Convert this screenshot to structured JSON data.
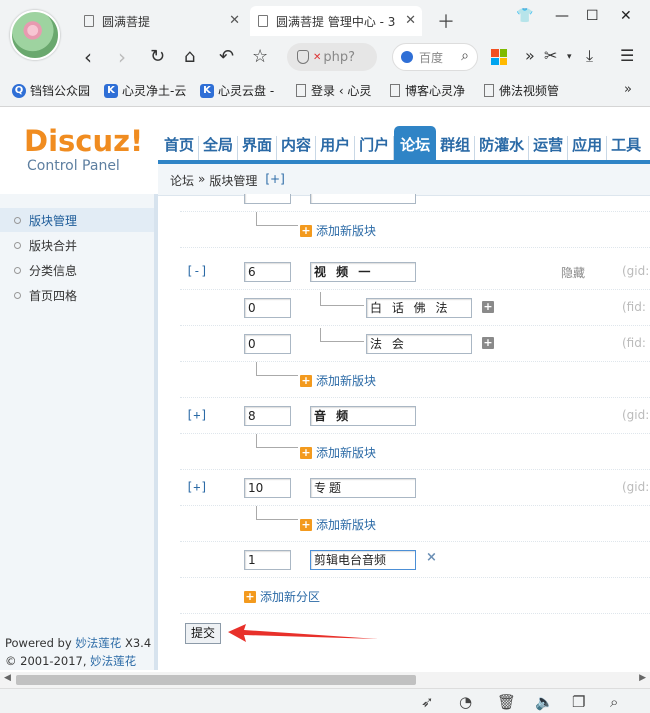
{
  "browser": {
    "tabs": [
      {
        "title": "圆满菩提"
      },
      {
        "title": "圆满菩提 管理中心 - 3"
      }
    ],
    "address_text": "php?",
    "search_placeholder": "百度",
    "bookmarks": [
      {
        "label": "铛铛公众园",
        "icon_color": "#2f6fd6",
        "icon": "Q"
      },
      {
        "label": "心灵净土-云",
        "icon_color": "#2f6fd6",
        "icon": "K"
      },
      {
        "label": "心灵云盘 -",
        "icon_color": "#2f6fd6",
        "icon": "K"
      },
      {
        "label": "登录 ‹ 心灵",
        "icon_color": "",
        "icon": "doc"
      },
      {
        "label": "博客心灵净",
        "icon_color": "",
        "icon": "doc"
      },
      {
        "label": "佛法视频管",
        "icon_color": "",
        "icon": "doc"
      }
    ]
  },
  "logo": {
    "main": "Discuz!",
    "sub": "Control Panel"
  },
  "topnav": [
    "首页",
    "全局",
    "界面",
    "内容",
    "用户",
    "门户",
    "论坛",
    "群组",
    "防灌水",
    "运营",
    "应用",
    "工具"
  ],
  "topnav_active": "论坛",
  "breadcrumb": {
    "first": "论坛",
    "sep": "»",
    "second": "版块管理",
    "plus": "[+]"
  },
  "sidebar": {
    "items": [
      "版块管理",
      "版块合并",
      "分类信息",
      "首页四格"
    ],
    "active": "版块管理",
    "powered_prefix": "Powered by",
    "powered_link": "妙法莲花",
    "version": "X3.4",
    "copyright": "© 2001-2017,",
    "copyright_link": "妙法莲花"
  },
  "forum_rows": {
    "add_board": "添加新版块",
    "add_category": "添加新分区",
    "hidden": "隐藏",
    "gid_label": "(gid:",
    "fid_label": "(fid:",
    "cat_video": {
      "toggle": "[-]",
      "order": "6",
      "name": "视 频 一"
    },
    "sub_plain": {
      "order": "0",
      "name": "白 话 佛 法"
    },
    "sub_fahui": {
      "order": "0",
      "name": "法 会"
    },
    "cat_audio": {
      "toggle": "[+]",
      "order": "8",
      "name": "音 频"
    },
    "cat_topic": {
      "toggle": "[+]",
      "order": "10",
      "name": "专题"
    },
    "new_cat": {
      "order": "1",
      "name": "剪辑电台音频",
      "delete": "×"
    }
  },
  "submit_label": "提交",
  "annotation_color": "#e8302a"
}
